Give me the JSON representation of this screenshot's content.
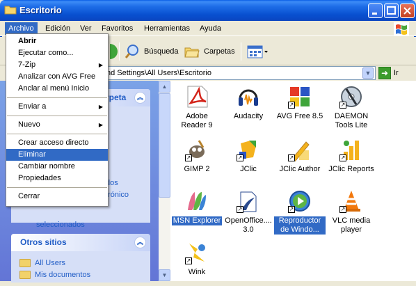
{
  "window": {
    "title": "Escritorio"
  },
  "menubar": [
    "Archivo",
    "Edición",
    "Ver",
    "Favoritos",
    "Herramientas",
    "Ayuda"
  ],
  "toolbar": {
    "search": "Búsqueda",
    "folders": "Carpetas"
  },
  "address": {
    "path": "nd Settings\\All Users\\Escritorio",
    "go": "Ir"
  },
  "taskpane": {
    "panel1_title_fragment": "rpeta",
    "fragments": [
      "dos",
      "trónico",
      "seleccionados"
    ],
    "other_places_title": "Otros sitios",
    "other_places": [
      "All Users",
      "Mis documentos"
    ]
  },
  "items": [
    {
      "label": "Adobe Reader 9",
      "icon": "adobe-reader-icon"
    },
    {
      "label": "Audacity",
      "icon": "audacity-icon"
    },
    {
      "label": "AVG Free 8.5",
      "icon": "avg-icon"
    },
    {
      "label": "DAEMON Tools Lite",
      "icon": "daemon-tools-icon"
    },
    {
      "label": "GIMP 2",
      "icon": "gimp-icon"
    },
    {
      "label": "JClic",
      "icon": "jclic-icon"
    },
    {
      "label": "JClic Author",
      "icon": "jclic-author-icon"
    },
    {
      "label": "JClic Reports",
      "icon": "jclic-reports-icon"
    },
    {
      "label": "MSN Explorer",
      "icon": "msn-icon"
    },
    {
      "label": "OpenOffice.... 3.0",
      "icon": "openoffice-icon"
    },
    {
      "label": "Reproductor de Windo...",
      "icon": "media-player-icon"
    },
    {
      "label": "VLC media player",
      "icon": "vlc-icon"
    },
    {
      "label": "Wink",
      "icon": "wink-icon"
    }
  ],
  "dropdown": {
    "items": [
      {
        "label": "Abrir",
        "bold": true
      },
      {
        "label": "Ejecutar como..."
      },
      {
        "label": "7-Zip",
        "submenu": true
      },
      {
        "label": "Analizar con AVG Free"
      },
      {
        "label": "Anclar al menú Inicio"
      },
      {
        "label": "Enviar a",
        "submenu": true
      },
      {
        "label": "Nuevo",
        "submenu": true
      },
      {
        "label": "Crear acceso directo"
      },
      {
        "label": "Eliminar",
        "highlighted": true
      },
      {
        "label": "Cambiar nombre"
      },
      {
        "label": "Propiedades"
      },
      {
        "label": "Cerrar"
      }
    ]
  }
}
